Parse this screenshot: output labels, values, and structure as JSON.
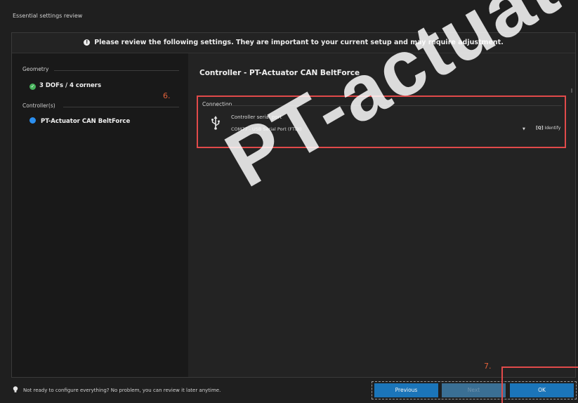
{
  "window": {
    "title": "Essential settings review"
  },
  "banner": {
    "text": "Please review the following settings. They are important to your current setup and may require adjustment."
  },
  "left_panel": {
    "geometry_heading": "Geometry",
    "geometry_item": "3 DOFs / 4 corners",
    "controllers_heading": "Controller(s)",
    "controller_item": "PT-Actuator CAN BeltForce"
  },
  "right_panel": {
    "title": "Controller  -  PT-Actuator CAN BeltForce",
    "connection": {
      "heading": "Connection",
      "port_label": "Controller serial port",
      "port_value": "COM77 - USB Serial Port (FTDI)",
      "identify_label": "Identify"
    }
  },
  "annotations": {
    "step6": "6.",
    "step7": "7."
  },
  "watermark": {
    "text": "PT-actuat"
  },
  "footer": {
    "hint": "Not ready to configure everything? No problem, you can review it later anytime.",
    "previous_label": "Previous",
    "next_label": "Next",
    "ok_label": "OK"
  },
  "colors": {
    "accent_blue": "#1b75b9",
    "check_green": "#47b35c",
    "controller_dot": "#2b8ff0",
    "highlight_red": "#e14a4a",
    "annotation_orange": "#e0603a"
  },
  "icons": {
    "banner": "info-icon",
    "geometry": "check-circle-icon",
    "controller": "status-dot-icon",
    "usb": "usb-icon",
    "identify": "identify-icon",
    "footer": "lightbulb-icon"
  }
}
